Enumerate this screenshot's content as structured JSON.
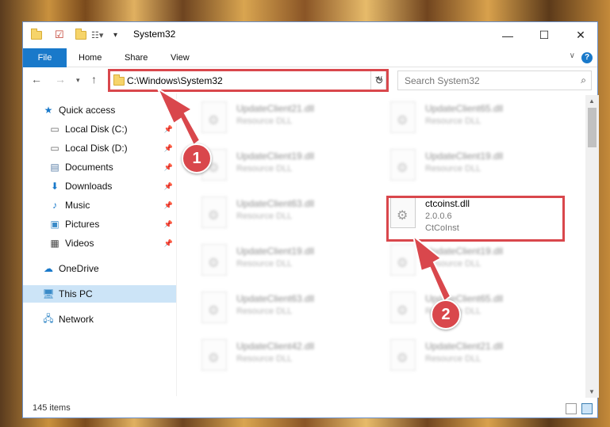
{
  "window": {
    "title": "System32",
    "controls": {
      "minimize": "—",
      "maximize": "☐",
      "close": "✕"
    }
  },
  "ribbon": {
    "tabs": [
      "File",
      "Home",
      "Share",
      "View"
    ],
    "help": "?"
  },
  "address": {
    "path": "C:\\Windows\\System32",
    "search_placeholder": "Search System32"
  },
  "sidebar": {
    "items": [
      {
        "label": "Quick access",
        "icon": "star-icon"
      },
      {
        "label": "Local Disk (C:)",
        "icon": "drive-icon",
        "pinned": true
      },
      {
        "label": "Local Disk (D:)",
        "icon": "drive-icon",
        "pinned": true
      },
      {
        "label": "Documents",
        "icon": "documents-icon",
        "pinned": true
      },
      {
        "label": "Downloads",
        "icon": "download-icon",
        "pinned": true
      },
      {
        "label": "Music",
        "icon": "music-icon",
        "pinned": true
      },
      {
        "label": "Pictures",
        "icon": "pictures-icon",
        "pinned": true
      },
      {
        "label": "Videos",
        "icon": "videos-icon",
        "pinned": true
      },
      {
        "label": "OneDrive",
        "icon": "cloud-icon"
      },
      {
        "label": "This PC",
        "icon": "computer-icon",
        "selected": true
      },
      {
        "label": "Network",
        "icon": "network-icon"
      }
    ]
  },
  "files": [
    {
      "name": "UpdateClient21.dll",
      "type": "Resource DLL"
    },
    {
      "name": "UpdateClient65.dll",
      "type": "Resource DLL"
    },
    {
      "name": "UpdateClient19.dll",
      "type": "Resource DLL"
    },
    {
      "name": "UpdateClient19.dll",
      "type": "Resource DLL"
    },
    {
      "name": "UpdateClient63.dll",
      "type": "Resource DLL"
    },
    {
      "name": "ctcoinst.dll",
      "version": "2.0.0.6",
      "type": "CtCoInst"
    },
    {
      "name": "UpdateClient19.dll",
      "type": "Resource DLL"
    },
    {
      "name": "UpdateClient19.dll",
      "type": "Resource DLL"
    },
    {
      "name": "UpdateClient63.dll",
      "type": "Resource DLL"
    },
    {
      "name": "UpdateClient65.dll",
      "type": "Resource DLL"
    },
    {
      "name": "UpdateClient42.dll",
      "type": "Resource DLL"
    },
    {
      "name": "UpdateClient21.dll",
      "type": "Resource DLL"
    }
  ],
  "status": {
    "count": "145 items"
  },
  "callouts": [
    "1",
    "2"
  ],
  "colors": {
    "accent": "#1979ca",
    "highlight": "#d9474c",
    "selection": "#cce4f7"
  }
}
